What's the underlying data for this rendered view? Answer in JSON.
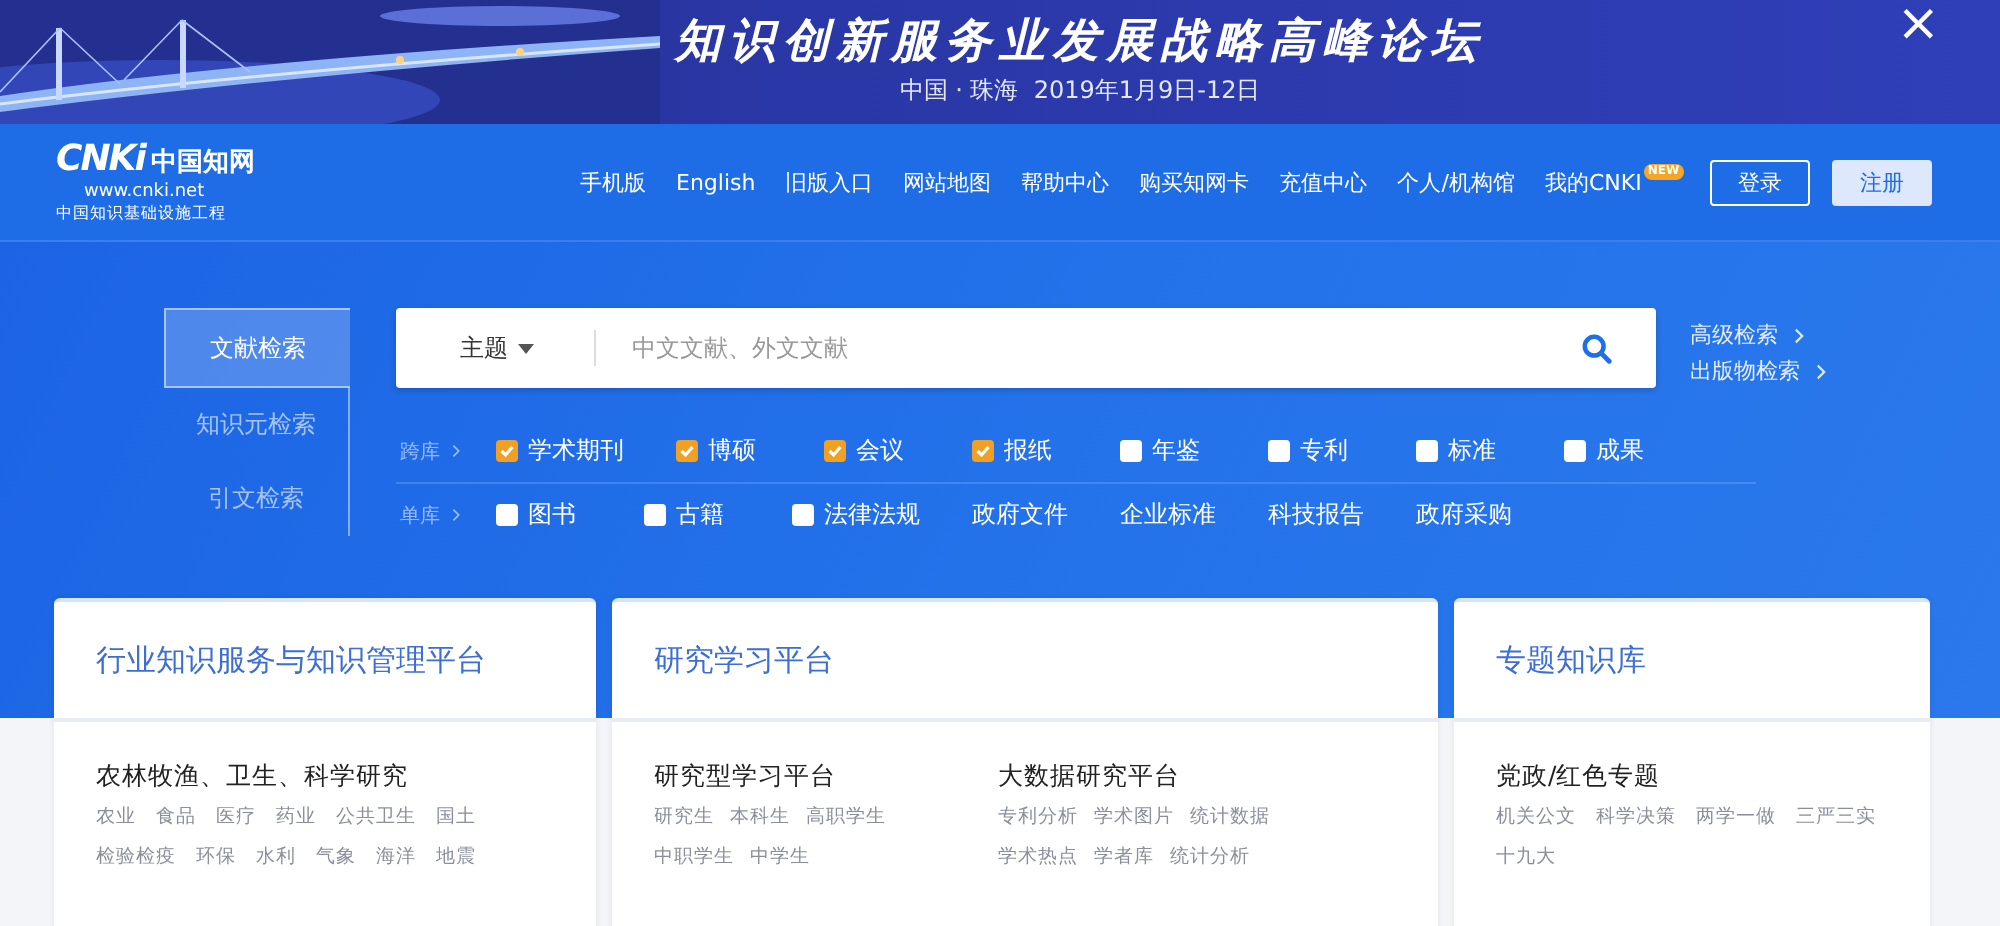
{
  "banner": {
    "title": "知识创新服务业发展战略高峰论坛",
    "subtitle": "中国 · 珠海  2019年1月9日-12日",
    "close": "×"
  },
  "header": {
    "logo": {
      "mark": "CNKi",
      "name": "中国知网",
      "url": "www.cnki.net",
      "tagline": "中国知识基础设施工程"
    },
    "nav": [
      {
        "label": "手机版"
      },
      {
        "label": "English"
      },
      {
        "label": "旧版入口"
      },
      {
        "label": "网站地图"
      },
      {
        "label": "帮助中心"
      },
      {
        "label": "购买知网卡"
      },
      {
        "label": "充值中心"
      },
      {
        "label": "个人/机构馆"
      },
      {
        "label": "我的CNKI",
        "badge": "NEW"
      }
    ],
    "login": "登录",
    "register": "注册"
  },
  "search": {
    "tabs": [
      {
        "label": "文献检索",
        "selected": true
      },
      {
        "label": "知识元检索",
        "selected": false
      },
      {
        "label": "引文检索",
        "selected": false
      }
    ],
    "field": "主题",
    "placeholder": "中文文献、外文文献",
    "side_links": [
      "高级检索",
      "出版物检索"
    ]
  },
  "cross_db": {
    "label": "跨库",
    "items": [
      {
        "label": "学术期刊",
        "kind": "checkbox",
        "checked": true
      },
      {
        "label": "博硕",
        "kind": "checkbox",
        "checked": true
      },
      {
        "label": "会议",
        "kind": "checkbox",
        "checked": true
      },
      {
        "label": "报纸",
        "kind": "checkbox",
        "checked": true
      },
      {
        "label": "年鉴",
        "kind": "checkbox",
        "checked": false
      },
      {
        "label": "专利",
        "kind": "checkbox",
        "checked": false
      },
      {
        "label": "标准",
        "kind": "checkbox",
        "checked": false
      },
      {
        "label": "成果",
        "kind": "checkbox",
        "checked": false
      }
    ]
  },
  "single_db": {
    "label": "单库",
    "items": [
      {
        "label": "图书",
        "kind": "checkbox",
        "checked": false
      },
      {
        "label": "古籍",
        "kind": "checkbox",
        "checked": false
      },
      {
        "label": "法律法规",
        "kind": "checkbox",
        "checked": false
      },
      {
        "label": "政府文件",
        "kind": "link"
      },
      {
        "label": "企业标准",
        "kind": "link"
      },
      {
        "label": "科技报告",
        "kind": "link"
      },
      {
        "label": "政府采购",
        "kind": "link"
      }
    ]
  },
  "cards": [
    {
      "title": "行业知识服务与知识管理平台",
      "rows": [
        [
          {
            "heading": "农林牧渔、卫生、科学研究",
            "links": [
              "农业",
              "食品",
              "医疗",
              "药业",
              "公共卫生",
              "国土",
              "检验检疫",
              "环保",
              "水利",
              "气象",
              "海洋",
              "地震"
            ]
          }
        ]
      ]
    },
    {
      "title": "研究学习平台",
      "rows": [
        [
          {
            "heading": "研究型学习平台",
            "links": [
              "研究生",
              "本科生",
              "高职学生",
              "中职学生",
              "中学生"
            ]
          },
          {
            "heading": "大数据研究平台",
            "links": [
              "专利分析",
              "学术图片",
              "统计数据",
              "学术热点",
              "学者库",
              "统计分析"
            ]
          }
        ]
      ]
    },
    {
      "title": "专题知识库",
      "rows": [
        [
          {
            "heading": "党政/红色专题",
            "links": [
              "机关公文",
              "科学决策",
              "两学一做",
              "三严三实",
              "十九大"
            ]
          }
        ]
      ]
    }
  ]
}
